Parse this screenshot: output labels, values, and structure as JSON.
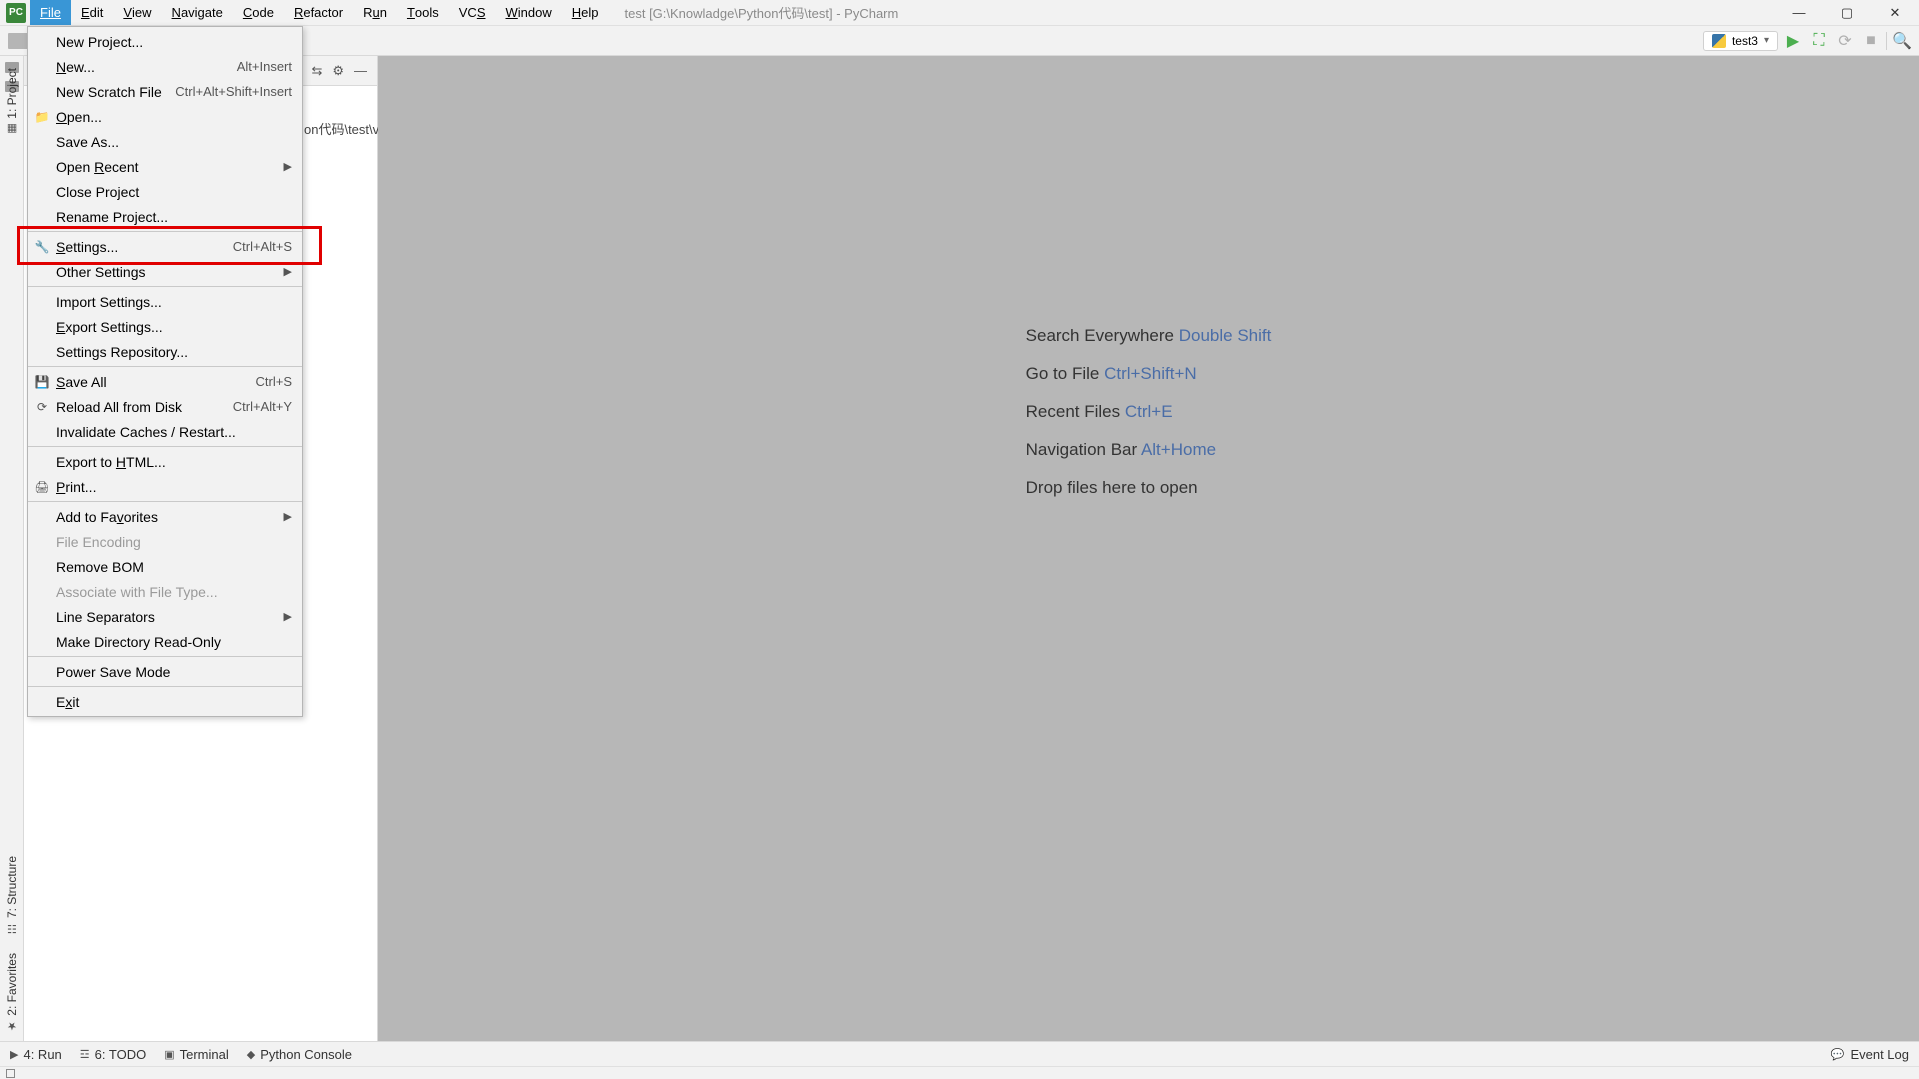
{
  "title": "test [G:\\Knowladge\\Python代码\\test] - PyCharm",
  "menubar": [
    "File",
    "Edit",
    "View",
    "Navigate",
    "Code",
    "Refactor",
    "Run",
    "Tools",
    "VCS",
    "Window",
    "Help"
  ],
  "run_config": {
    "name": "test3"
  },
  "file_menu": [
    {
      "label": "New Project...",
      "type": "item"
    },
    {
      "label": "New...",
      "u": "N",
      "shortcut": "Alt+Insert",
      "type": "item"
    },
    {
      "label": "New Scratch File",
      "shortcut": "Ctrl+Alt+Shift+Insert",
      "type": "item"
    },
    {
      "label": "Open...",
      "u": "O",
      "icon": "folder",
      "type": "item"
    },
    {
      "label": "Save As...",
      "type": "item"
    },
    {
      "label": "Open Recent",
      "u": "R",
      "submenu": true,
      "type": "item"
    },
    {
      "label": "Close Project",
      "type": "item"
    },
    {
      "label": "Rename Project...",
      "type": "item"
    },
    {
      "type": "sep"
    },
    {
      "label": "Settings...",
      "u": "S",
      "icon": "wrench",
      "shortcut": "Ctrl+Alt+S",
      "type": "item",
      "highlight": true
    },
    {
      "label": "Other Settings",
      "submenu": true,
      "type": "item"
    },
    {
      "type": "sep"
    },
    {
      "label": "Import Settings...",
      "type": "item"
    },
    {
      "label": "Export Settings...",
      "u": "E",
      "type": "item"
    },
    {
      "label": "Settings Repository...",
      "type": "item"
    },
    {
      "type": "sep"
    },
    {
      "label": "Save All",
      "u": "S",
      "icon": "save",
      "shortcut": "Ctrl+S",
      "type": "item"
    },
    {
      "label": "Reload All from Disk",
      "icon": "reload",
      "shortcut": "Ctrl+Alt+Y",
      "type": "item"
    },
    {
      "label": "Invalidate Caches / Restart...",
      "type": "item"
    },
    {
      "type": "sep"
    },
    {
      "label": "Export to HTML...",
      "u": "H",
      "type": "item"
    },
    {
      "label": "Print...",
      "u": "P",
      "icon": "print",
      "type": "item"
    },
    {
      "type": "sep"
    },
    {
      "label": "Add to Favorites",
      "u": "v",
      "submenu": true,
      "type": "item"
    },
    {
      "label": "File Encoding",
      "type": "item",
      "disabled": true
    },
    {
      "label": "Remove BOM",
      "type": "item"
    },
    {
      "label": "Associate with File Type...",
      "type": "item",
      "disabled": true
    },
    {
      "label": "Line Separators",
      "submenu": true,
      "type": "item"
    },
    {
      "label": "Make Directory Read-Only",
      "type": "item"
    },
    {
      "type": "sep"
    },
    {
      "label": "Power Save Mode",
      "type": "item"
    },
    {
      "type": "sep"
    },
    {
      "label": "Exit",
      "u": "x",
      "type": "item"
    }
  ],
  "sidebar": {
    "path_fragment": "on代码\\test\\ve"
  },
  "left_tabs": {
    "project": "1: Project",
    "structure": "7: Structure",
    "favorites": "2: Favorites"
  },
  "welcome": [
    {
      "text": "Search Everywhere ",
      "shortcut": "Double Shift"
    },
    {
      "text": "Go to File ",
      "shortcut": "Ctrl+Shift+N"
    },
    {
      "text": "Recent Files ",
      "shortcut": "Ctrl+E"
    },
    {
      "text": "Navigation Bar ",
      "shortcut": "Alt+Home"
    },
    {
      "text": "Drop files here to open",
      "shortcut": ""
    }
  ],
  "bottom": {
    "run": "4: Run",
    "todo": "6: TODO",
    "terminal": "Terminal",
    "console": "Python Console",
    "eventlog": "Event Log"
  }
}
